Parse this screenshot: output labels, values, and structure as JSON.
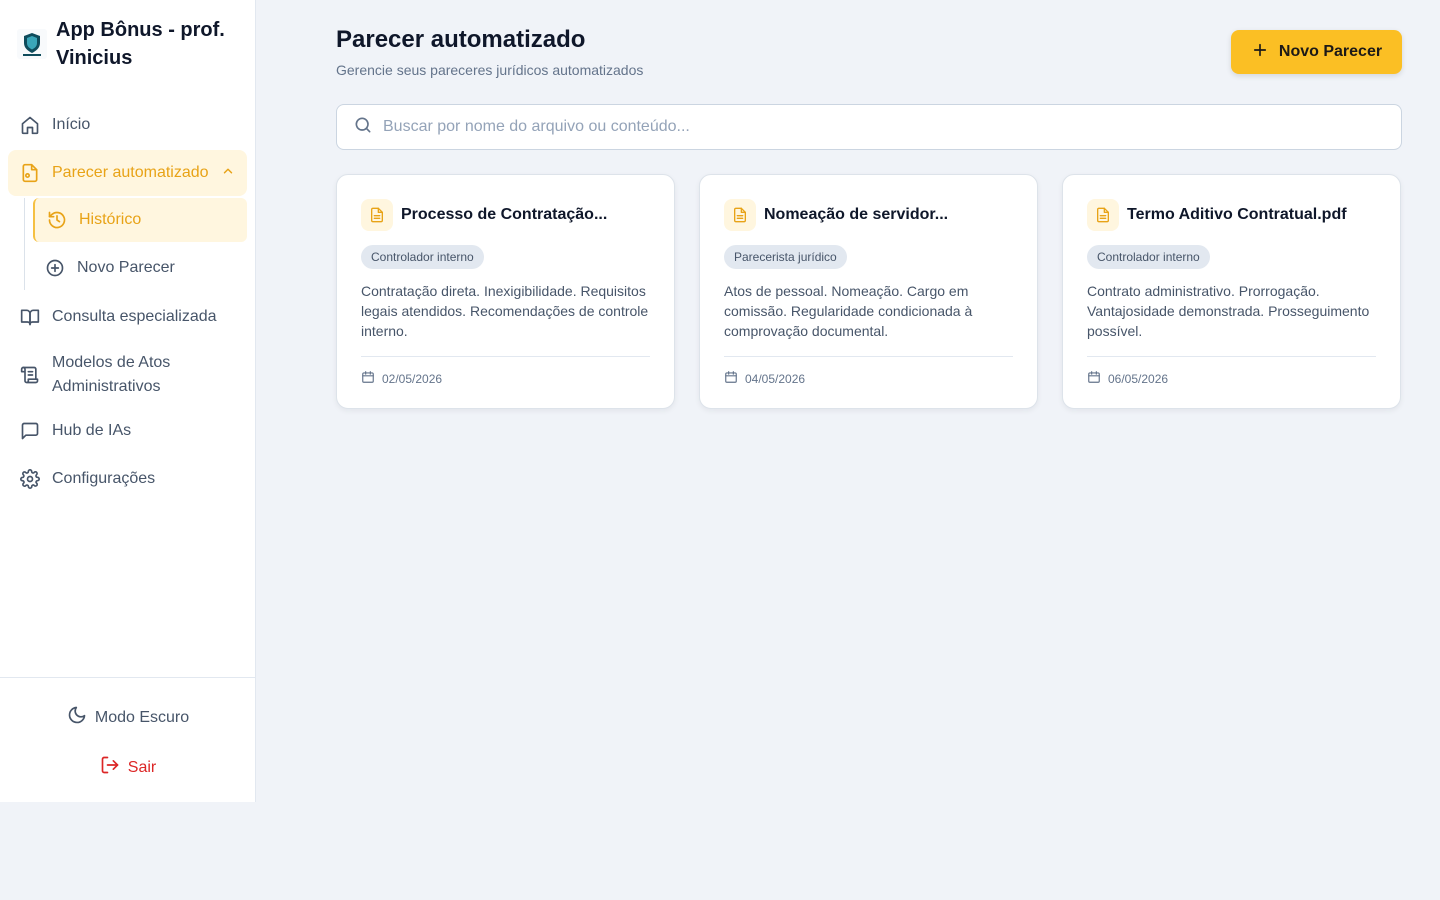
{
  "app": {
    "title": "App Bônus - prof. Vinicius"
  },
  "colors": {
    "accent": "#fbbf24",
    "accent_text": "#e8a317",
    "danger": "#dc2626",
    "background": "#f0f3f8"
  },
  "sidebar": {
    "items": [
      {
        "label": "Início",
        "icon": "home-icon"
      },
      {
        "label": "Parecer automatizado",
        "icon": "file-icon",
        "expanded": true
      },
      {
        "label": "Consulta especializada",
        "icon": "book-icon"
      },
      {
        "label": "Modelos de Atos Administrativos",
        "icon": "scroll-icon"
      },
      {
        "label": "Hub de IAs",
        "icon": "message-icon"
      },
      {
        "label": "Configurações",
        "icon": "gear-icon"
      }
    ],
    "subitems": [
      {
        "label": "Histórico",
        "icon": "history-icon",
        "active": true
      },
      {
        "label": "Novo Parecer",
        "icon": "plus-circle-icon"
      }
    ],
    "dark_mode_label": "Modo Escuro",
    "logout_label": "Sair"
  },
  "header": {
    "title": "Parecer automatizado",
    "subtitle": "Gerencie seus pareceres jurídicos automatizados",
    "new_button_label": "Novo Parecer"
  },
  "search": {
    "placeholder": "Buscar por nome do arquivo ou conteúdo..."
  },
  "cards": [
    {
      "title": "Processo de Contratação...",
      "badge": "Controlador interno",
      "description": "Contratação direta. Inexigibilidade. Requisitos legais atendidos. Recomendações de controle interno.",
      "date": "02/05/2026"
    },
    {
      "title": "Nomeação de servidor...",
      "badge": "Parecerista jurídico",
      "description": "Atos de pessoal. Nomeação. Cargo em comissão. Regularidade condicionada à comprovação documental.",
      "date": "04/05/2026"
    },
    {
      "title": "Termo Aditivo Contratual.pdf",
      "badge": "Controlador interno",
      "description": "Contrato administrativo. Prorrogação. Vantajosidade demonstrada. Prosseguimento possível.",
      "date": "06/05/2026"
    }
  ]
}
